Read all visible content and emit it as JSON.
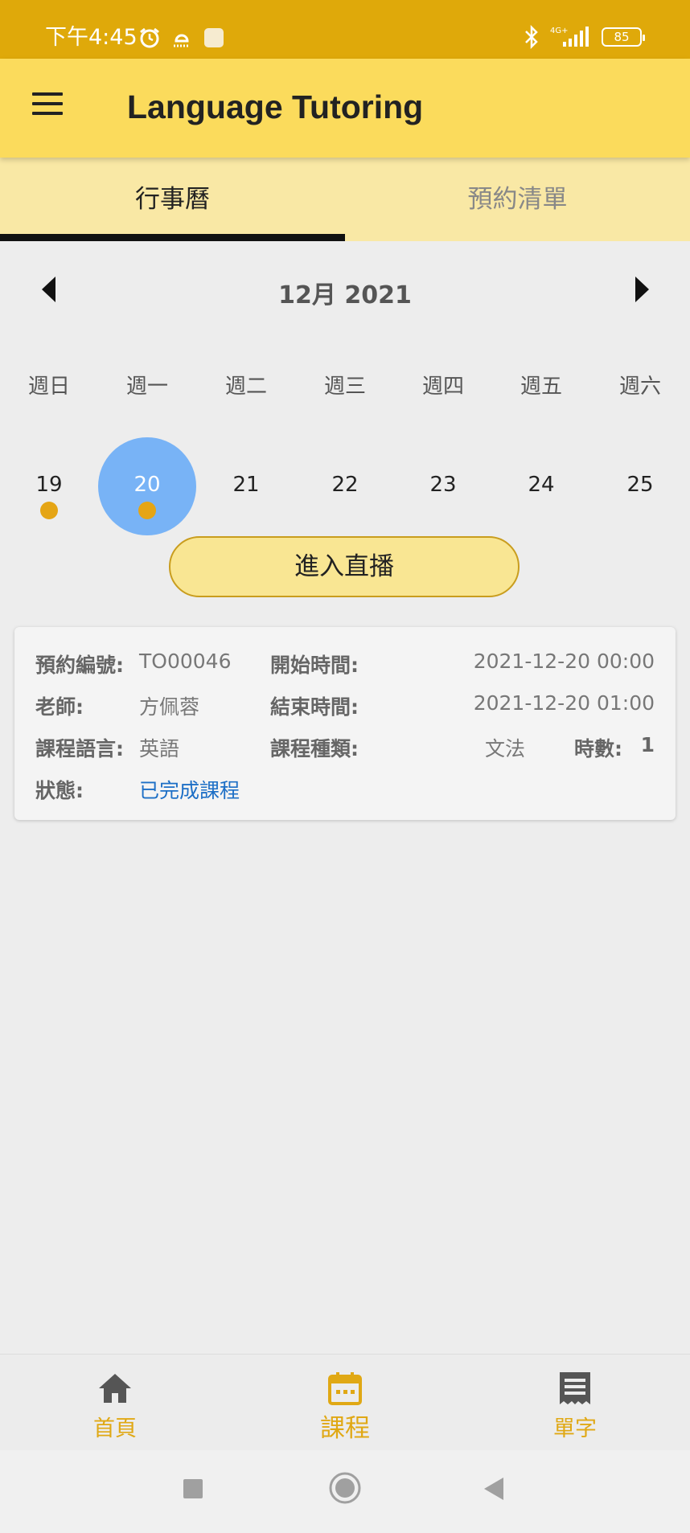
{
  "status_bar": {
    "time": "下午4:45",
    "network": "4G+",
    "battery": "85"
  },
  "app_bar": {
    "title": "Language Tutoring"
  },
  "tabs": [
    {
      "label": "行事曆",
      "active": true
    },
    {
      "label": "預約清單",
      "active": false
    }
  ],
  "calendar": {
    "month_label": "12月 2021",
    "weekdays": [
      "週日",
      "週一",
      "週二",
      "週三",
      "週四",
      "週五",
      "週六"
    ],
    "dates": [
      {
        "day": "19",
        "selected": false,
        "has_event": true
      },
      {
        "day": "20",
        "selected": true,
        "has_event": true
      },
      {
        "day": "21",
        "selected": false,
        "has_event": false
      },
      {
        "day": "22",
        "selected": false,
        "has_event": false
      },
      {
        "day": "23",
        "selected": false,
        "has_event": false
      },
      {
        "day": "24",
        "selected": false,
        "has_event": false
      },
      {
        "day": "25",
        "selected": false,
        "has_event": false
      }
    ]
  },
  "live_button": {
    "label": "進入直播"
  },
  "booking": {
    "id_label": "預約編號:",
    "id_value": "TO00046",
    "start_label": "開始時間:",
    "start_value": "2021-12-20 00:00",
    "teacher_label": "老師:",
    "teacher_value": "方佩蓉",
    "end_label": "結束時間:",
    "end_value": "2021-12-20 01:00",
    "language_label": "課程語言:",
    "language_value": "英語",
    "type_label": "課程種類:",
    "type_value": "文法",
    "hours_label": "時數:",
    "hours_value": "1",
    "status_label": "狀態:",
    "status_value": "已完成課程"
  },
  "bottom_nav": [
    {
      "label": "首頁",
      "icon": "home-icon",
      "active": false
    },
    {
      "label": "課程",
      "icon": "calendar-icon",
      "active": true
    },
    {
      "label": "單字",
      "icon": "vocabulary-list-icon",
      "active": false
    }
  ],
  "colors": {
    "status_bar": "#dfa90a",
    "app_bar": "#fbdb5c",
    "tabs_bg": "#f9e8a5",
    "selected_date": "#78b3f6",
    "event_dot": "#e5a515",
    "status_text": "#1d6fc6",
    "nav_accent": "#e0a814"
  }
}
